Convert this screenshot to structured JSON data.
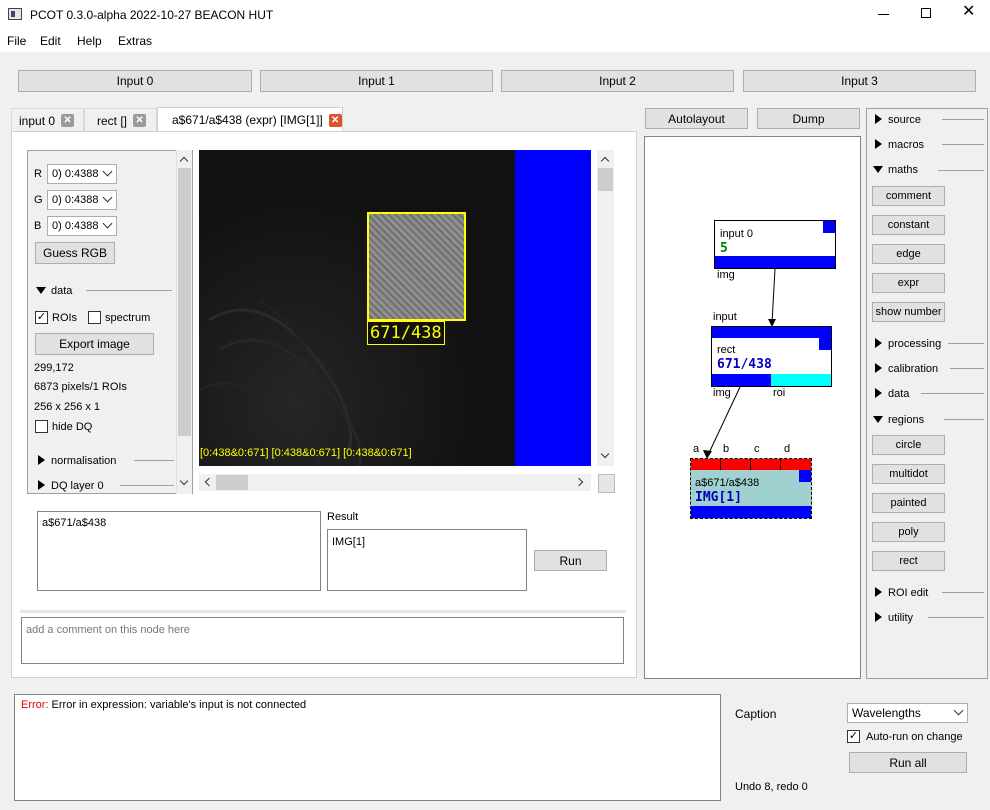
{
  "window": {
    "title": "PCOT 0.3.0-alpha 2022-10-27 BEACON HUT"
  },
  "menu": [
    "File",
    "Edit",
    "Help",
    "Extras"
  ],
  "inputs": [
    "Input 0",
    "Input 1",
    "Input 2",
    "Input 3"
  ],
  "tabs": [
    {
      "label": "input 0",
      "active": false
    },
    {
      "label": "rect []",
      "active": false
    },
    {
      "label": "a$671/a$438 (expr) [IMG[1]]",
      "active": true
    }
  ],
  "graph_buttons": {
    "autolayout": "Autolayout",
    "dump": "Dump"
  },
  "channels": [
    {
      "label": "R",
      "value": "0) 0:4388"
    },
    {
      "label": "G",
      "value": "0) 0:4388"
    },
    {
      "label": "B",
      "value": "0) 0:4388"
    }
  ],
  "guess_rgb": "Guess RGB",
  "data_section": "data",
  "rois_label": "ROIs",
  "rois_checked": true,
  "spectrum_label": "spectrum",
  "spectrum_checked": false,
  "export_image": "Export image",
  "stats": [
    "299,172",
    "6873 pixels/1 ROIs",
    "256 x 256 x 1"
  ],
  "hide_dq": "hide DQ",
  "normalisation": "normalisation",
  "dq_layer": "DQ layer 0",
  "image": {
    "roi_label": "671/438",
    "source_label": "[0:438&0:671] [0:438&0:671] [0:438&0:671]"
  },
  "expression": "a$671/a$438",
  "result_label": "Result",
  "result_value": "IMG[1]",
  "run": "Run",
  "comment_placeholder": "add a comment on this node here",
  "graph": {
    "input0": {
      "title": "input 0",
      "value": "5",
      "out": "img"
    },
    "rect": {
      "in": "input",
      "title": "rect",
      "value": "671/438",
      "out1": "img",
      "out2": "roi"
    },
    "expr": {
      "ins": [
        "a",
        "b",
        "c",
        "d"
      ],
      "title": "a$671/a$438",
      "value": "IMG[1]"
    }
  },
  "palette": {
    "sections": [
      "source",
      "macros",
      "maths",
      "processing",
      "calibration",
      "data",
      "regions",
      "ROI edit",
      "utility"
    ],
    "maths_items": [
      "comment",
      "constant",
      "edge",
      "expr",
      "show number"
    ],
    "regions_items": [
      "circle",
      "multidot",
      "painted",
      "poly",
      "rect"
    ]
  },
  "log": {
    "prefix": "Error:",
    "message": " Error in expression: variable's input is not connected"
  },
  "caption_label": "Caption",
  "caption_value": "Wavelengths",
  "autorun_label": "Auto-run on change",
  "autorun_checked": true,
  "run_all": "Run all",
  "undo": "Undo 8, redo 0",
  "colors": {
    "accent": "#0000e0",
    "error": "#e00000",
    "roi": "#ffff00",
    "node_in": "#ff0000",
    "cyan": "#00ffff"
  }
}
